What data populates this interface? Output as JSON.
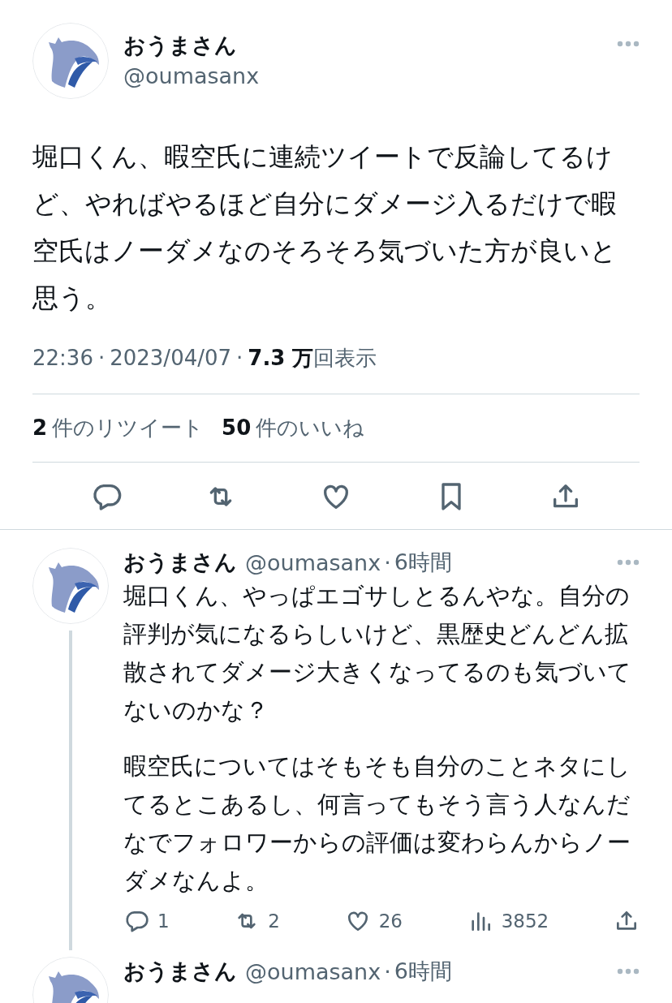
{
  "main_tweet": {
    "name": "おうまさん",
    "handle": "@oumasanx",
    "text": "堀口くん、暇空氏に連続ツイートで反論してるけど、やればやるほど自分にダメージ入るだけで暇空氏はノーダメなのそろそろ気づいた方が良いと思う。",
    "time": "22:36",
    "separator": "·",
    "date": "2023/04/07",
    "views_count": "7.3 万",
    "views_label": "回表示",
    "stats": [
      {
        "count": "2",
        "label": "件のリツイート"
      },
      {
        "count": "50",
        "label": "件のいいね"
      }
    ],
    "actions": [
      {
        "kind": "reply"
      },
      {
        "kind": "retweet"
      },
      {
        "kind": "like"
      },
      {
        "kind": "bookmark"
      },
      {
        "kind": "share"
      }
    ]
  },
  "replies": [
    {
      "name": "おうまさん",
      "handle": "@oumasanx",
      "separator": "·",
      "age": "6時間",
      "paragraphs": [
        "堀口くん、やっぱエゴサしとるんやな。自分の評判が気になるらしいけど、黒歴史どんどん拡散されてダメージ大きくなってるのも気づいてないのかな？",
        "暇空氏についてはそもそも自分のことネタにしてるとこあるし、何言ってもそう言う人なんだなでフォロワーからの評価は変わらんからノーダメなんよ。"
      ],
      "actions": [
        {
          "kind": "reply",
          "count": "1"
        },
        {
          "kind": "retweet",
          "count": "2"
        },
        {
          "kind": "like",
          "count": "26"
        },
        {
          "kind": "views",
          "count": "3852"
        },
        {
          "kind": "share"
        }
      ]
    },
    {
      "name": "おうまさん",
      "handle": "@oumasanx",
      "separator": "·",
      "age": "6時間"
    }
  ]
}
